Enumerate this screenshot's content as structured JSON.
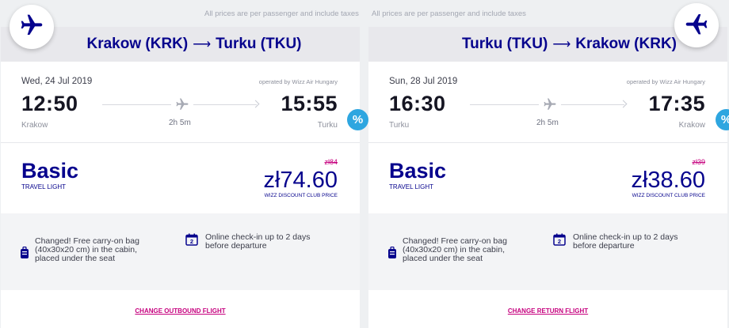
{
  "price_note": "All prices are per passenger and include taxes",
  "outbound": {
    "route_from": "Krakow (KRK)",
    "route_arrow": "⟶",
    "route_to": "Turku (TKU)",
    "date": "Wed, 24 Jul 2019",
    "operated_by": "operated by Wizz Air Hungary",
    "departure_time": "12:50",
    "arrival_time": "15:55",
    "duration": "2h 5m",
    "departure_city": "Krakow",
    "arrival_city": "Turku",
    "discount_symbol": "%",
    "fare_name": "Basic",
    "fare_subtitle": "TRAVEL LIGHT",
    "old_price": "zł84",
    "price": "zł74.60",
    "price_label": "WIZZ DISCOUNT CLUB PRICE",
    "bag_text_1": "Changed! Free carry-on bag",
    "bag_text_2": "(40x30x20 cm) in the cabin,",
    "bag_text_3": "placed under the seat",
    "checkin_text_1": "Online check-in up to 2 days",
    "checkin_text_2": "before departure",
    "calendar_day": "2",
    "change_link": "CHANGE OUTBOUND FLIGHT"
  },
  "return": {
    "route_from": "Turku (TKU)",
    "route_arrow": "⟶",
    "route_to": "Krakow (KRK)",
    "date": "Sun, 28 Jul 2019",
    "operated_by": "operated by Wizz Air Hungary",
    "departure_time": "16:30",
    "arrival_time": "17:35",
    "duration": "2h 5m",
    "departure_city": "Turku",
    "arrival_city": "Krakow",
    "discount_symbol": "%",
    "fare_name": "Basic",
    "fare_subtitle": "TRAVEL LIGHT",
    "old_price": "zł39",
    "price": "zł38.60",
    "price_label": "WIZZ DISCOUNT CLUB PRICE",
    "bag_text_1": "Changed! Free carry-on bag",
    "bag_text_2": "(40x30x20 cm) in the cabin,",
    "bag_text_3": "placed under the seat",
    "checkin_text_1": "Online check-in up to 2 days",
    "checkin_text_2": "before departure",
    "calendar_day": "2",
    "change_link": "CHANGE RETURN FLIGHT"
  },
  "icons": {
    "badge": "airplane-icon",
    "timeline": "airplane-icon",
    "bag": "carry-on-bag-icon",
    "checkin": "calendar-icon"
  },
  "colors": {
    "brand_blue": "#06038d",
    "brand_magenta": "#c6007e",
    "discount_blue": "#2ea6e0",
    "route_band": "#e8e8ec"
  }
}
